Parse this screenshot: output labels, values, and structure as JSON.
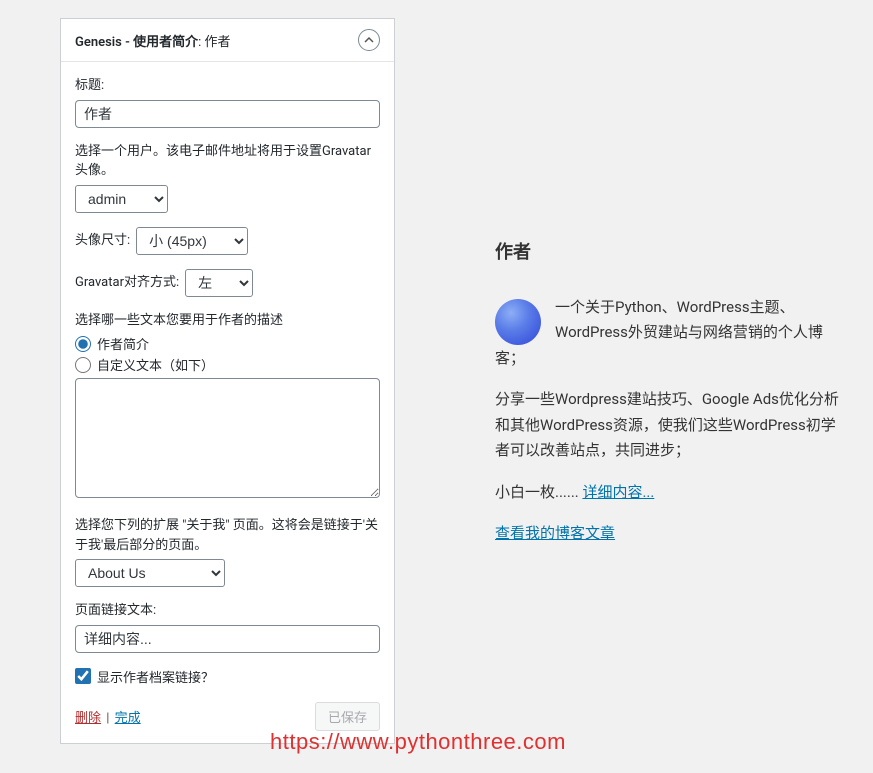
{
  "widget": {
    "title_prefix": "Genesis - 使用者简介",
    "title_suffix": ": 作者",
    "fields": {
      "title_label": "标题:",
      "title_value": "作者",
      "user_label": "选择一个用户。该电子邮件地址将用于设置Gravatar头像。",
      "user_value": "admin",
      "avatar_size_label": "头像尺寸:",
      "avatar_size_value": "小 (45px)",
      "gravatar_align_label": "Gravatar对齐方式:",
      "gravatar_align_value": "左",
      "desc_label": "选择哪一些文本您要用于作者的描述",
      "radio_bio": "作者简介",
      "radio_custom": "自定义文本（如下）",
      "page_label": "选择您下列的扩展 \"关于我\" 页面。这将会是链接于'关于我'最后部分的页面。",
      "page_value": "About Us",
      "link_text_label": "页面链接文本:",
      "link_text_value": "详细内容...",
      "show_archive_label": "显示作者档案链接？"
    },
    "footer": {
      "delete": "删除",
      "done": "完成",
      "saved": "已保存"
    }
  },
  "preview": {
    "title": "作者",
    "p1": "一个关于Python、WordPress主题、WordPress外贸建站与网络营销的个人博客；",
    "p2": "分享一些Wordpress建站技巧、Google Ads优化分析和其他WordPress资源，使我们这些WordPress初学者可以改善站点，共同进步；",
    "p3_prefix": "小白一枚...... ",
    "p3_link": "详细内容...",
    "archive_link": "查看我的博客文章"
  },
  "watermark": "https://www.pythonthree.com"
}
